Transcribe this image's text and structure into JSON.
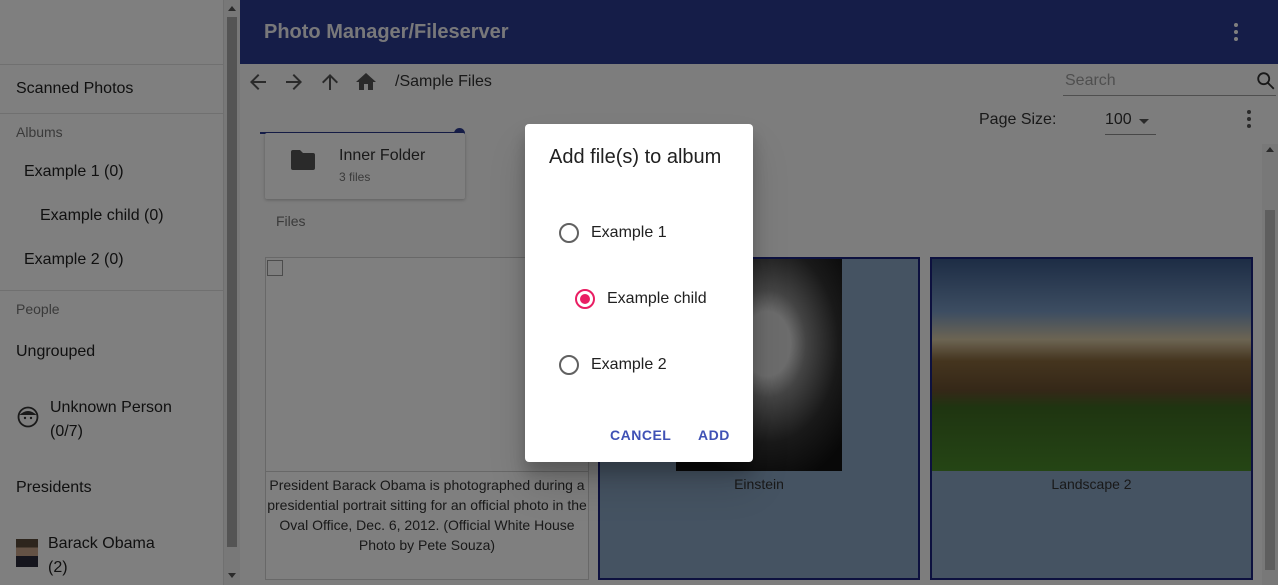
{
  "app": {
    "title": "Photo Manager/Fileserver"
  },
  "sidebar": {
    "scanned": "Scanned Photos",
    "albums_header": "Albums",
    "albums": [
      {
        "label": "Example 1 (0)"
      },
      {
        "label": "Example child (0)"
      },
      {
        "label": "Example 2 (0)"
      }
    ],
    "people_header": "People",
    "ungrouped": "Ungrouped",
    "unknown_person": {
      "line1": "Unknown Person",
      "line2": "(0/7)"
    },
    "presidents": "Presidents",
    "barack": {
      "line1": "Barack Obama",
      "line2": "(2)"
    }
  },
  "toolbar": {
    "path": "/Sample Files",
    "search_placeholder": "Search",
    "page_size_label": "Page Size:",
    "page_size_value": "100"
  },
  "folder": {
    "name": "Inner Folder",
    "count": "3 files"
  },
  "files_label": "Files",
  "files": [
    {
      "caption": "President Barack Obama is photographed during a presidential portrait sitting for an official photo in the Oval Office, Dec. 6, 2012. (Official White House Photo by Pete Souza)"
    },
    {
      "caption": "Einstein"
    },
    {
      "caption": "Landscape 2"
    }
  ],
  "dialog": {
    "title": "Add file(s) to album",
    "options": [
      {
        "label": "Example 1",
        "checked": false
      },
      {
        "label": "Example child",
        "checked": true
      },
      {
        "label": "Example 2",
        "checked": false
      }
    ],
    "cancel": "CANCEL",
    "add": "ADD"
  },
  "colors": {
    "primary": "#2b3a91",
    "accent": "#e91e63",
    "button": "#3f51b5"
  }
}
